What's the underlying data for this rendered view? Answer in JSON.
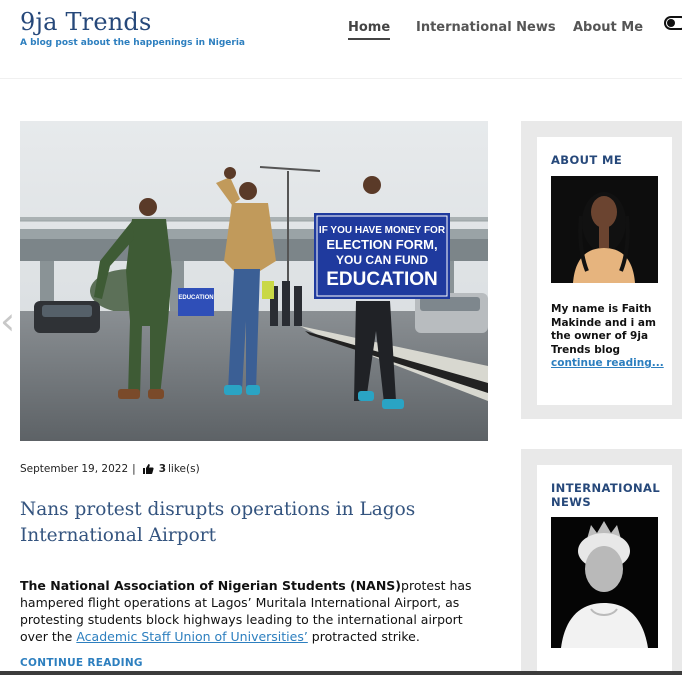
{
  "site": {
    "title": "9ja Trends",
    "tagline": "A blog post about the happenings in Nigeria"
  },
  "nav": {
    "items": [
      "Home",
      "International News",
      "About Me"
    ],
    "active": "Home"
  },
  "hero_image": {
    "sign_text_line1": "IF YOU HAVE MONEY FOR",
    "sign_text_line2": "ELECTION FORM,",
    "sign_text_line3": "YOU CAN FUND",
    "sign_text_line4": "EDUCATION",
    "small_sign_text": "EDUCATION"
  },
  "post": {
    "date": "September 19, 2022",
    "likes_count": "3",
    "likes_label": "like(s)",
    "title": "Nans protest disrupts operations in Lagos International Airport",
    "excerpt_bold": "The National Association of Nigerian Students (NANS)",
    "excerpt_text_1": "protest has hampered flight operations at Lagos’ Muritala International Airport, as protesting students block highways leading to the international airport over the ",
    "excerpt_link": "Academic Staff Union of Universities’",
    "excerpt_text_2": " protracted strike.",
    "continue_label": "CONTINUE READING"
  },
  "sidebar": {
    "about": {
      "title": "ABOUT ME",
      "text": "My name is Faith Makinde and i am the owner of 9ja Trends blog",
      "link": "continue reading..."
    },
    "international": {
      "title_line1": "INTERNATIONAL",
      "title_line2": "NEWS"
    }
  },
  "colors": {
    "brand": "#26487a",
    "accent": "#2d7fbf",
    "sidebar_bg": "#e9e9e9"
  },
  "icons": [
    "thumbs-up-icon",
    "chevron-left-icon",
    "dark-mode-toggle-icon"
  ]
}
